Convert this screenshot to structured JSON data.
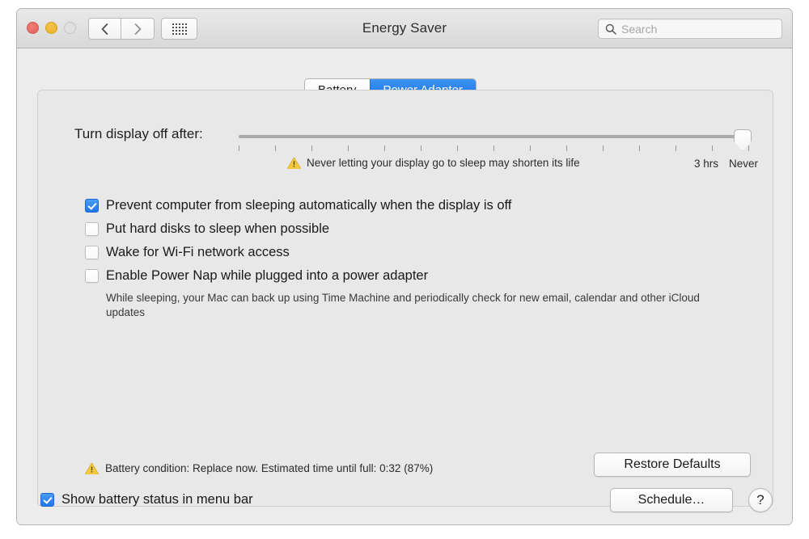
{
  "window": {
    "title": "Energy Saver",
    "traffic_lights": [
      "close",
      "minimize",
      "zoom-disabled"
    ],
    "nav": {
      "back": "back-arrow",
      "forward": "forward-arrow",
      "show_all": "grid-icon"
    },
    "search": {
      "placeholder": "Search",
      "value": "",
      "icon": "search-icon"
    }
  },
  "tabs": [
    {
      "label": "Battery",
      "selected": false
    },
    {
      "label": "Power Adapter",
      "selected": true
    }
  ],
  "slider": {
    "label": "Turn display off after:",
    "warning_text": "Never letting your display go to sleep may shorten its life",
    "warning_icon": "warning-triangle-icon",
    "tick_labels": [
      {
        "text": "3 hrs"
      },
      {
        "text": "Never"
      }
    ],
    "tick_count": 15,
    "value_label": "Never",
    "value_percent": 100
  },
  "checkboxes": [
    {
      "label": "Prevent computer from sleeping automatically when the display is off",
      "checked": true,
      "note": ""
    },
    {
      "label": "Put hard disks to sleep when possible",
      "checked": false,
      "note": ""
    },
    {
      "label": "Wake for Wi-Fi network access",
      "checked": false,
      "note": ""
    },
    {
      "label": "Enable Power Nap while plugged into a power adapter",
      "checked": false,
      "note": "While sleeping, your Mac can back up using Time Machine and periodically check for new email, calendar and other iCloud updates"
    }
  ],
  "battery_status": {
    "icon": "warning-triangle-icon",
    "text": "Battery condition: Replace now. Estimated time until full: 0:32 (87%)"
  },
  "buttons": {
    "restore_defaults": "Restore Defaults",
    "schedule": "Schedule…",
    "help": "?"
  },
  "bottom_checkbox": {
    "label": "Show battery status in menu bar",
    "checked": true
  },
  "colors": {
    "accent_blue": "#1f76ec",
    "tab_active_blue": "#2a80ef",
    "warning_yellow": "#f3c13a",
    "window_bg": "#ececec",
    "panel_bg": "#e8e8e8",
    "titlebar_top": "#e9e9e9",
    "titlebar_bottom": "#d8d8d8",
    "close_red": "#e0635c",
    "minimize_yellow": "#e8ae28",
    "zoom_disabled_gray": "#e0e0e0"
  }
}
